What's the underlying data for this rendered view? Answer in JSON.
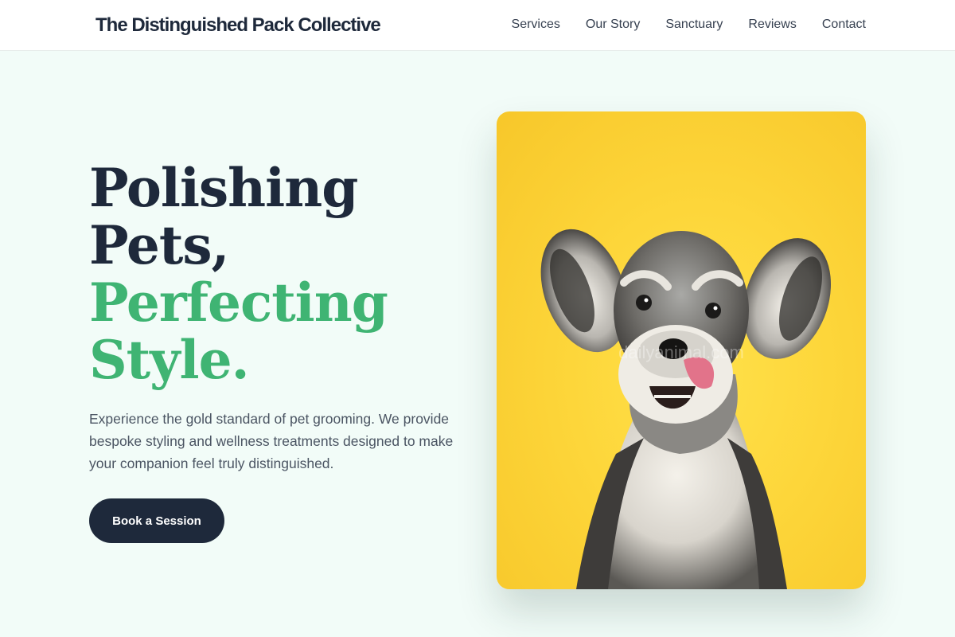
{
  "header": {
    "brand": "The Distinguished Pack Collective",
    "nav": [
      "Services",
      "Our Story",
      "Sanctuary",
      "Reviews",
      "Contact"
    ]
  },
  "hero": {
    "headline_line1": "Polishing",
    "headline_line2": "Pets,",
    "headline_line3": "Perfecting",
    "headline_line4": "Style.",
    "description": "Experience the gold standard of pet grooming. We provide bespoke styling and wellness treatments designed to make your companion feel truly distinguished.",
    "cta_label": "Book a Session",
    "image_watermark": "dailyanimal.com"
  },
  "colors": {
    "navy": "#1e293b",
    "green_accent": "#3fb473",
    "background": "#f2fcf8",
    "photo_yellow": "#fdd63a"
  }
}
